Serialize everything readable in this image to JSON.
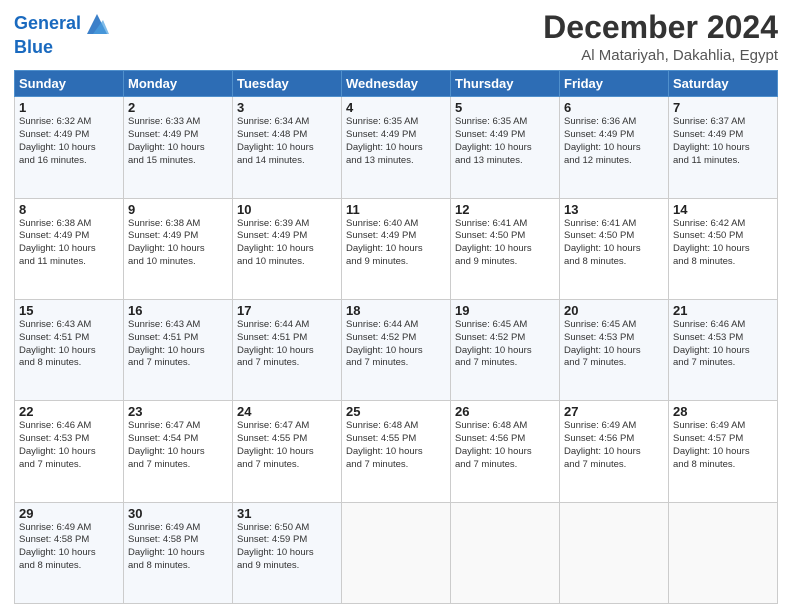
{
  "logo": {
    "line1": "General",
    "line2": "Blue"
  },
  "title": "December 2024",
  "location": "Al Matariyah, Dakahlia, Egypt",
  "days_of_week": [
    "Sunday",
    "Monday",
    "Tuesday",
    "Wednesday",
    "Thursday",
    "Friday",
    "Saturday"
  ],
  "weeks": [
    [
      {
        "day": 1,
        "sunrise": "6:32 AM",
        "sunset": "4:49 PM",
        "daylight": "10 hours and 16 minutes."
      },
      {
        "day": 2,
        "sunrise": "6:33 AM",
        "sunset": "4:49 PM",
        "daylight": "10 hours and 15 minutes."
      },
      {
        "day": 3,
        "sunrise": "6:34 AM",
        "sunset": "4:48 PM",
        "daylight": "10 hours and 14 minutes."
      },
      {
        "day": 4,
        "sunrise": "6:35 AM",
        "sunset": "4:49 PM",
        "daylight": "10 hours and 13 minutes."
      },
      {
        "day": 5,
        "sunrise": "6:35 AM",
        "sunset": "4:49 PM",
        "daylight": "10 hours and 13 minutes."
      },
      {
        "day": 6,
        "sunrise": "6:36 AM",
        "sunset": "4:49 PM",
        "daylight": "10 hours and 12 minutes."
      },
      {
        "day": 7,
        "sunrise": "6:37 AM",
        "sunset": "4:49 PM",
        "daylight": "10 hours and 11 minutes."
      }
    ],
    [
      {
        "day": 8,
        "sunrise": "6:38 AM",
        "sunset": "4:49 PM",
        "daylight": "10 hours and 11 minutes."
      },
      {
        "day": 9,
        "sunrise": "6:38 AM",
        "sunset": "4:49 PM",
        "daylight": "10 hours and 10 minutes."
      },
      {
        "day": 10,
        "sunrise": "6:39 AM",
        "sunset": "4:49 PM",
        "daylight": "10 hours and 10 minutes."
      },
      {
        "day": 11,
        "sunrise": "6:40 AM",
        "sunset": "4:49 PM",
        "daylight": "10 hours and 9 minutes."
      },
      {
        "day": 12,
        "sunrise": "6:41 AM",
        "sunset": "4:50 PM",
        "daylight": "10 hours and 9 minutes."
      },
      {
        "day": 13,
        "sunrise": "6:41 AM",
        "sunset": "4:50 PM",
        "daylight": "10 hours and 8 minutes."
      },
      {
        "day": 14,
        "sunrise": "6:42 AM",
        "sunset": "4:50 PM",
        "daylight": "10 hours and 8 minutes."
      }
    ],
    [
      {
        "day": 15,
        "sunrise": "6:43 AM",
        "sunset": "4:51 PM",
        "daylight": "10 hours and 8 minutes."
      },
      {
        "day": 16,
        "sunrise": "6:43 AM",
        "sunset": "4:51 PM",
        "daylight": "10 hours and 7 minutes."
      },
      {
        "day": 17,
        "sunrise": "6:44 AM",
        "sunset": "4:51 PM",
        "daylight": "10 hours and 7 minutes."
      },
      {
        "day": 18,
        "sunrise": "6:44 AM",
        "sunset": "4:52 PM",
        "daylight": "10 hours and 7 minutes."
      },
      {
        "day": 19,
        "sunrise": "6:45 AM",
        "sunset": "4:52 PM",
        "daylight": "10 hours and 7 minutes."
      },
      {
        "day": 20,
        "sunrise": "6:45 AM",
        "sunset": "4:53 PM",
        "daylight": "10 hours and 7 minutes."
      },
      {
        "day": 21,
        "sunrise": "6:46 AM",
        "sunset": "4:53 PM",
        "daylight": "10 hours and 7 minutes."
      }
    ],
    [
      {
        "day": 22,
        "sunrise": "6:46 AM",
        "sunset": "4:53 PM",
        "daylight": "10 hours and 7 minutes."
      },
      {
        "day": 23,
        "sunrise": "6:47 AM",
        "sunset": "4:54 PM",
        "daylight": "10 hours and 7 minutes."
      },
      {
        "day": 24,
        "sunrise": "6:47 AM",
        "sunset": "4:55 PM",
        "daylight": "10 hours and 7 minutes."
      },
      {
        "day": 25,
        "sunrise": "6:48 AM",
        "sunset": "4:55 PM",
        "daylight": "10 hours and 7 minutes."
      },
      {
        "day": 26,
        "sunrise": "6:48 AM",
        "sunset": "4:56 PM",
        "daylight": "10 hours and 7 minutes."
      },
      {
        "day": 27,
        "sunrise": "6:49 AM",
        "sunset": "4:56 PM",
        "daylight": "10 hours and 7 minutes."
      },
      {
        "day": 28,
        "sunrise": "6:49 AM",
        "sunset": "4:57 PM",
        "daylight": "10 hours and 8 minutes."
      }
    ],
    [
      {
        "day": 29,
        "sunrise": "6:49 AM",
        "sunset": "4:58 PM",
        "daylight": "10 hours and 8 minutes."
      },
      {
        "day": 30,
        "sunrise": "6:49 AM",
        "sunset": "4:58 PM",
        "daylight": "10 hours and 8 minutes."
      },
      {
        "day": 31,
        "sunrise": "6:50 AM",
        "sunset": "4:59 PM",
        "daylight": "10 hours and 9 minutes."
      },
      null,
      null,
      null,
      null
    ]
  ]
}
